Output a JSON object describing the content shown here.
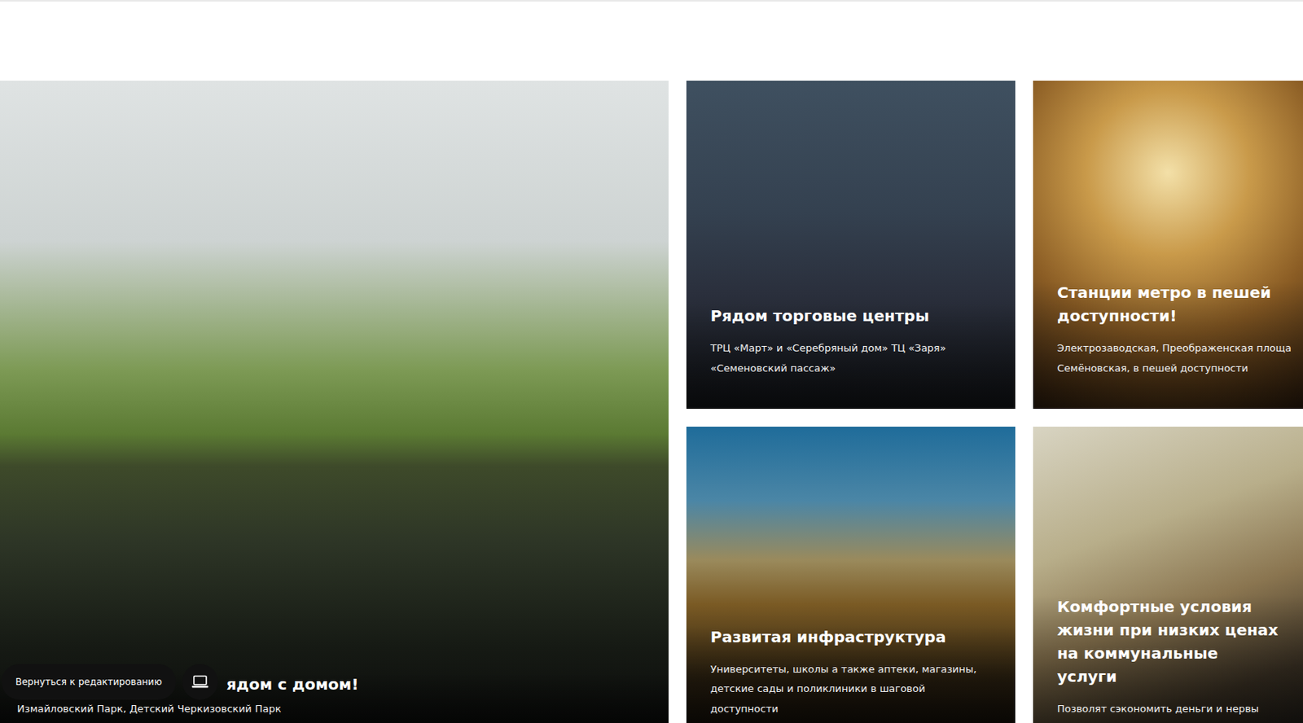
{
  "overlay": {
    "edit_button": "Вернуться к редактированию"
  },
  "feature": {
    "title": "ядом с домом!",
    "description": "Измайловский Парк, Детский Черкизовский Парк"
  },
  "cards": [
    {
      "title": "Рядом торговые центры",
      "description_lines": [
        "ТРЦ «Март» и «Серебряный дом» ТЦ «Заря»",
        "«Семеновский пассаж»"
      ]
    },
    {
      "title": "Станции метро в пешей доступности!",
      "description_lines": [
        "Электрозаводская, Преображенская площа",
        "Семёновская, в пешей доступности"
      ]
    },
    {
      "title": "Развитая инфраструктура",
      "description_lines": [
        "Университеты, школы а также аптеки, магазины,",
        "детские сады и поликлиники в шаговой",
        "доступности"
      ]
    },
    {
      "title": "Комфортные условия жизни при низких ценах на коммунальные услуги",
      "description_lines": [
        "Позволят сэкономить деньги и нервы"
      ]
    }
  ]
}
